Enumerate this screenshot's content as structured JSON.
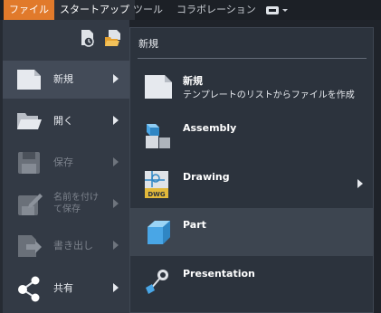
{
  "menubar": {
    "tabs": [
      {
        "label": "ファイル"
      },
      {
        "label": "スタートアップ"
      },
      {
        "label": "ツール"
      },
      {
        "label": "コラボレーション"
      }
    ]
  },
  "left_menu": {
    "items": [
      {
        "label": "新規",
        "enabled": true
      },
      {
        "label": "開く",
        "enabled": true
      },
      {
        "label": "保存",
        "enabled": false
      },
      {
        "label": "名前を付けて保存",
        "line1": "名前を付け",
        "line2": "て保存",
        "enabled": false
      },
      {
        "label": "書き出し",
        "enabled": false
      },
      {
        "label": "共有",
        "enabled": true
      }
    ]
  },
  "new_panel": {
    "title": "新規",
    "templates": [
      {
        "title": "新規",
        "subtitle": "テンプレートのリストからファイルを作成"
      },
      {
        "title": "Assembly"
      },
      {
        "title": "Drawing",
        "badge": "DWG"
      },
      {
        "title": "Part"
      },
      {
        "title": "Presentation"
      }
    ]
  },
  "colors": {
    "accent": "#e17a2b",
    "part_blue": "#49a6e6"
  }
}
